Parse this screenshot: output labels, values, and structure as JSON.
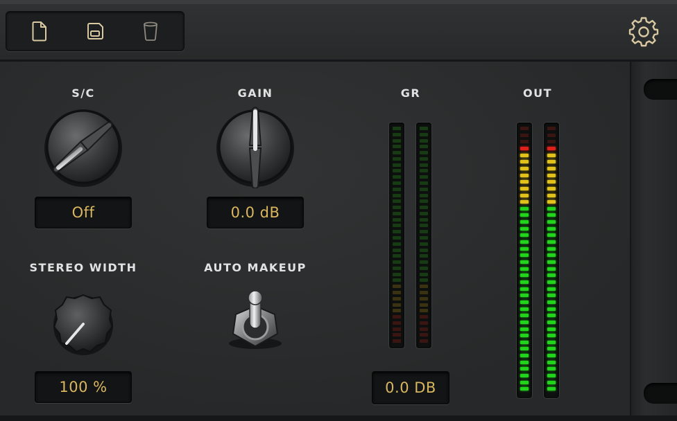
{
  "toolbar": {
    "buttons": [
      {
        "name": "new-preset",
        "icon": "new-file-icon"
      },
      {
        "name": "save-preset",
        "icon": "save-icon"
      },
      {
        "name": "delete-preset",
        "icon": "trash-icon"
      }
    ],
    "settings_icon": "gear-icon",
    "icon_color": "#d9c9a3"
  },
  "controls": {
    "sidechain": {
      "label": "S/C",
      "value": "Off"
    },
    "gain": {
      "label": "GAIN",
      "value": "0.0 dB"
    },
    "stereo_width": {
      "label": "STEREO WIDTH",
      "value": "100 %"
    },
    "auto_makeup": {
      "label": "AUTO MAKEUP",
      "state": "on"
    }
  },
  "meters": {
    "gr": {
      "label": "GR",
      "value": "0.0 DB",
      "channels": 2,
      "level": 0
    },
    "out": {
      "label": "OUT",
      "channels": 2,
      "level": 1
    }
  },
  "colors": {
    "value_text": "#d9b75f",
    "meter_green": "#22d41c",
    "meter_yellow": "#e2c21a",
    "meter_red": "#e0211b",
    "meter_off_green": "#173b12",
    "meter_off_red": "#3a1512"
  }
}
